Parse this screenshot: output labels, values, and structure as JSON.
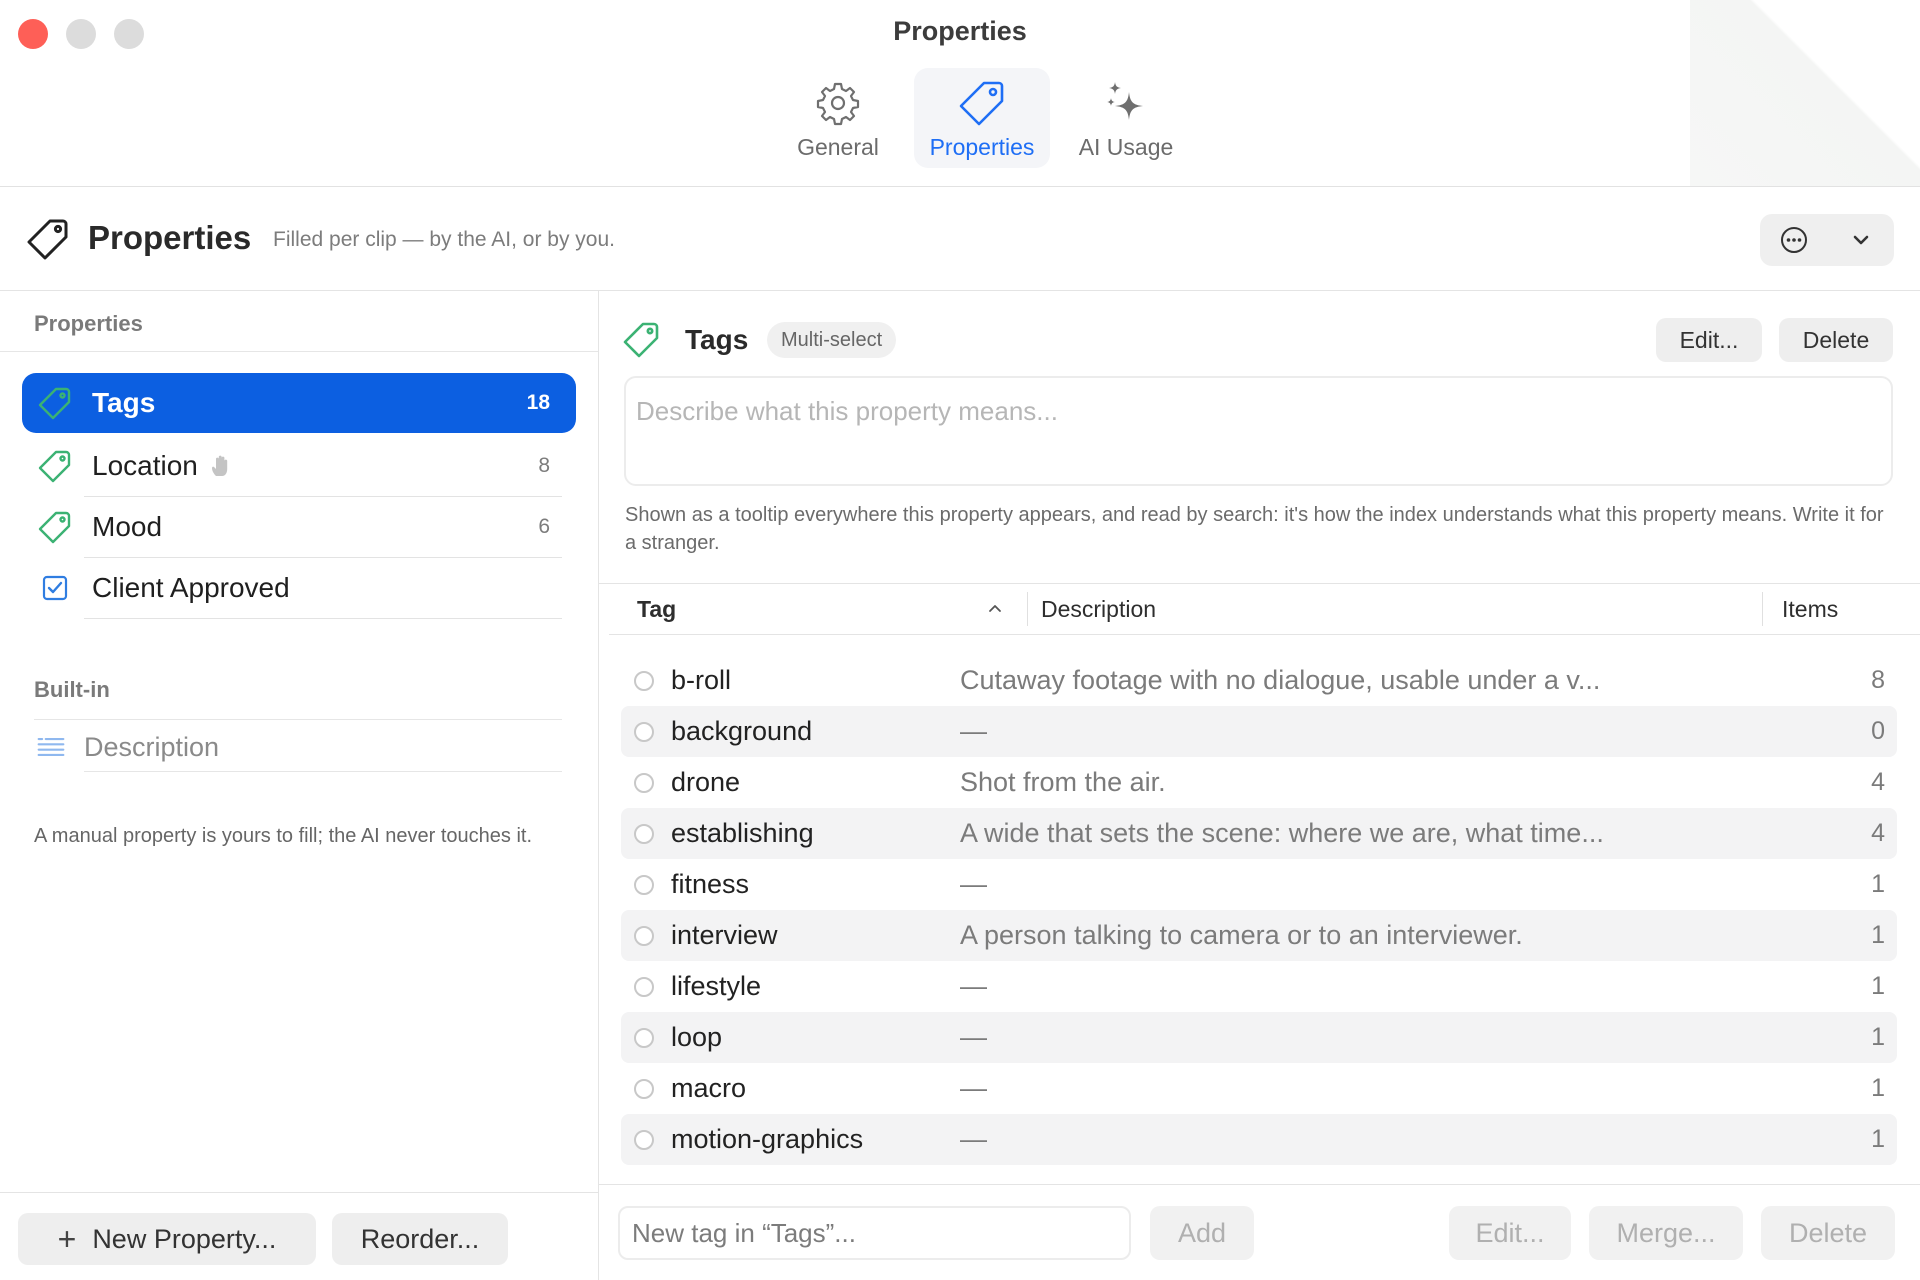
{
  "window": {
    "title": "Properties",
    "tabs": [
      {
        "label": "General",
        "icon": "gear-icon",
        "active": false
      },
      {
        "label": "Properties",
        "icon": "tag-icon",
        "active": true
      },
      {
        "label": "AI Usage",
        "icon": "sparkles-icon",
        "active": false
      }
    ]
  },
  "header": {
    "title": "Properties",
    "subtitle": "Filled per clip — by the AI, or by you.",
    "icon": "tag-icon"
  },
  "sidebar": {
    "section_label": "Properties",
    "items": [
      {
        "label": "Tags",
        "count": "18",
        "icon": "tag-icon",
        "selected": true
      },
      {
        "label": "Location",
        "count": "8",
        "icon": "tag-icon",
        "manual": true
      },
      {
        "label": "Mood",
        "count": "6",
        "icon": "tag-icon"
      },
      {
        "label": "Client Approved",
        "count": "",
        "icon": "checkbox-icon"
      }
    ],
    "builtin_label": "Built-in",
    "builtin_items": [
      {
        "label": "Description",
        "icon": "text-lines-icon"
      }
    ],
    "manual_note": "A manual property is yours to fill; the AI never touches it.",
    "new_property_label": "New Property...",
    "reorder_label": "Reorder..."
  },
  "detail": {
    "title": "Tags",
    "type_chip": "Multi-select",
    "edit_label": "Edit...",
    "delete_label": "Delete",
    "description_placeholder": "Describe what this property means...",
    "help_text": "Shown as a tooltip everywhere this property appears, and read by search: it's how the index understands what this property means. Write it for a stranger."
  },
  "table": {
    "columns": {
      "tag": "Tag",
      "description": "Description",
      "items": "Items"
    },
    "rows": [
      {
        "tag": "b-roll",
        "description": "Cutaway footage with no dialogue, usable under a v...",
        "items": "8"
      },
      {
        "tag": "background",
        "description": "—",
        "items": "0"
      },
      {
        "tag": "drone",
        "description": "Shot from the air.",
        "items": "4"
      },
      {
        "tag": "establishing",
        "description": "A wide that sets the scene: where we are, what time...",
        "items": "4"
      },
      {
        "tag": "fitness",
        "description": "—",
        "items": "1"
      },
      {
        "tag": "interview",
        "description": "A person talking to camera or to an interviewer.",
        "items": "1"
      },
      {
        "tag": "lifestyle",
        "description": "—",
        "items": "1"
      },
      {
        "tag": "loop",
        "description": "—",
        "items": "1"
      },
      {
        "tag": "macro",
        "description": "—",
        "items": "1"
      },
      {
        "tag": "motion-graphics",
        "description": "—",
        "items": "1"
      }
    ]
  },
  "footer": {
    "new_tag_placeholder": "New tag in “Tags”...",
    "add_label": "Add",
    "edit_label": "Edit...",
    "merge_label": "Merge...",
    "delete_label": "Delete"
  },
  "colors": {
    "accent": "#0c5fe1",
    "tab_active_text": "#1e6ef5",
    "tag_icon_green": "#3bb273",
    "close": "#fe5f57"
  }
}
